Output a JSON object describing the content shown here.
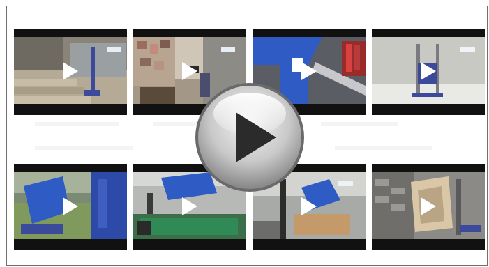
{
  "gallery": {
    "rows": [
      {
        "tiles": [
          {
            "name": "tile-hand-truck-stairs"
          },
          {
            "name": "tile-hand-truck-boxes"
          },
          {
            "name": "tile-blue-frame-closeup"
          },
          {
            "name": "tile-hand-truck-grey-wall"
          }
        ]
      },
      {
        "tiles": [
          {
            "name": "tile-tipping-skip-grass"
          },
          {
            "name": "tile-forklift-container"
          },
          {
            "name": "tile-forklift-skip"
          },
          {
            "name": "tile-crate-brick-wall"
          }
        ]
      }
    ]
  },
  "colors": {
    "frame_border": "#6f6f6f",
    "tile_letterbox": "#111111",
    "play_overlay": "#ffffff",
    "main_play_ring": "#8c8c8c",
    "main_play_triangle": "#2b2b2b"
  },
  "icons": {
    "tile_play": "play-triangle-icon",
    "main_play": "large-play-button-icon"
  }
}
